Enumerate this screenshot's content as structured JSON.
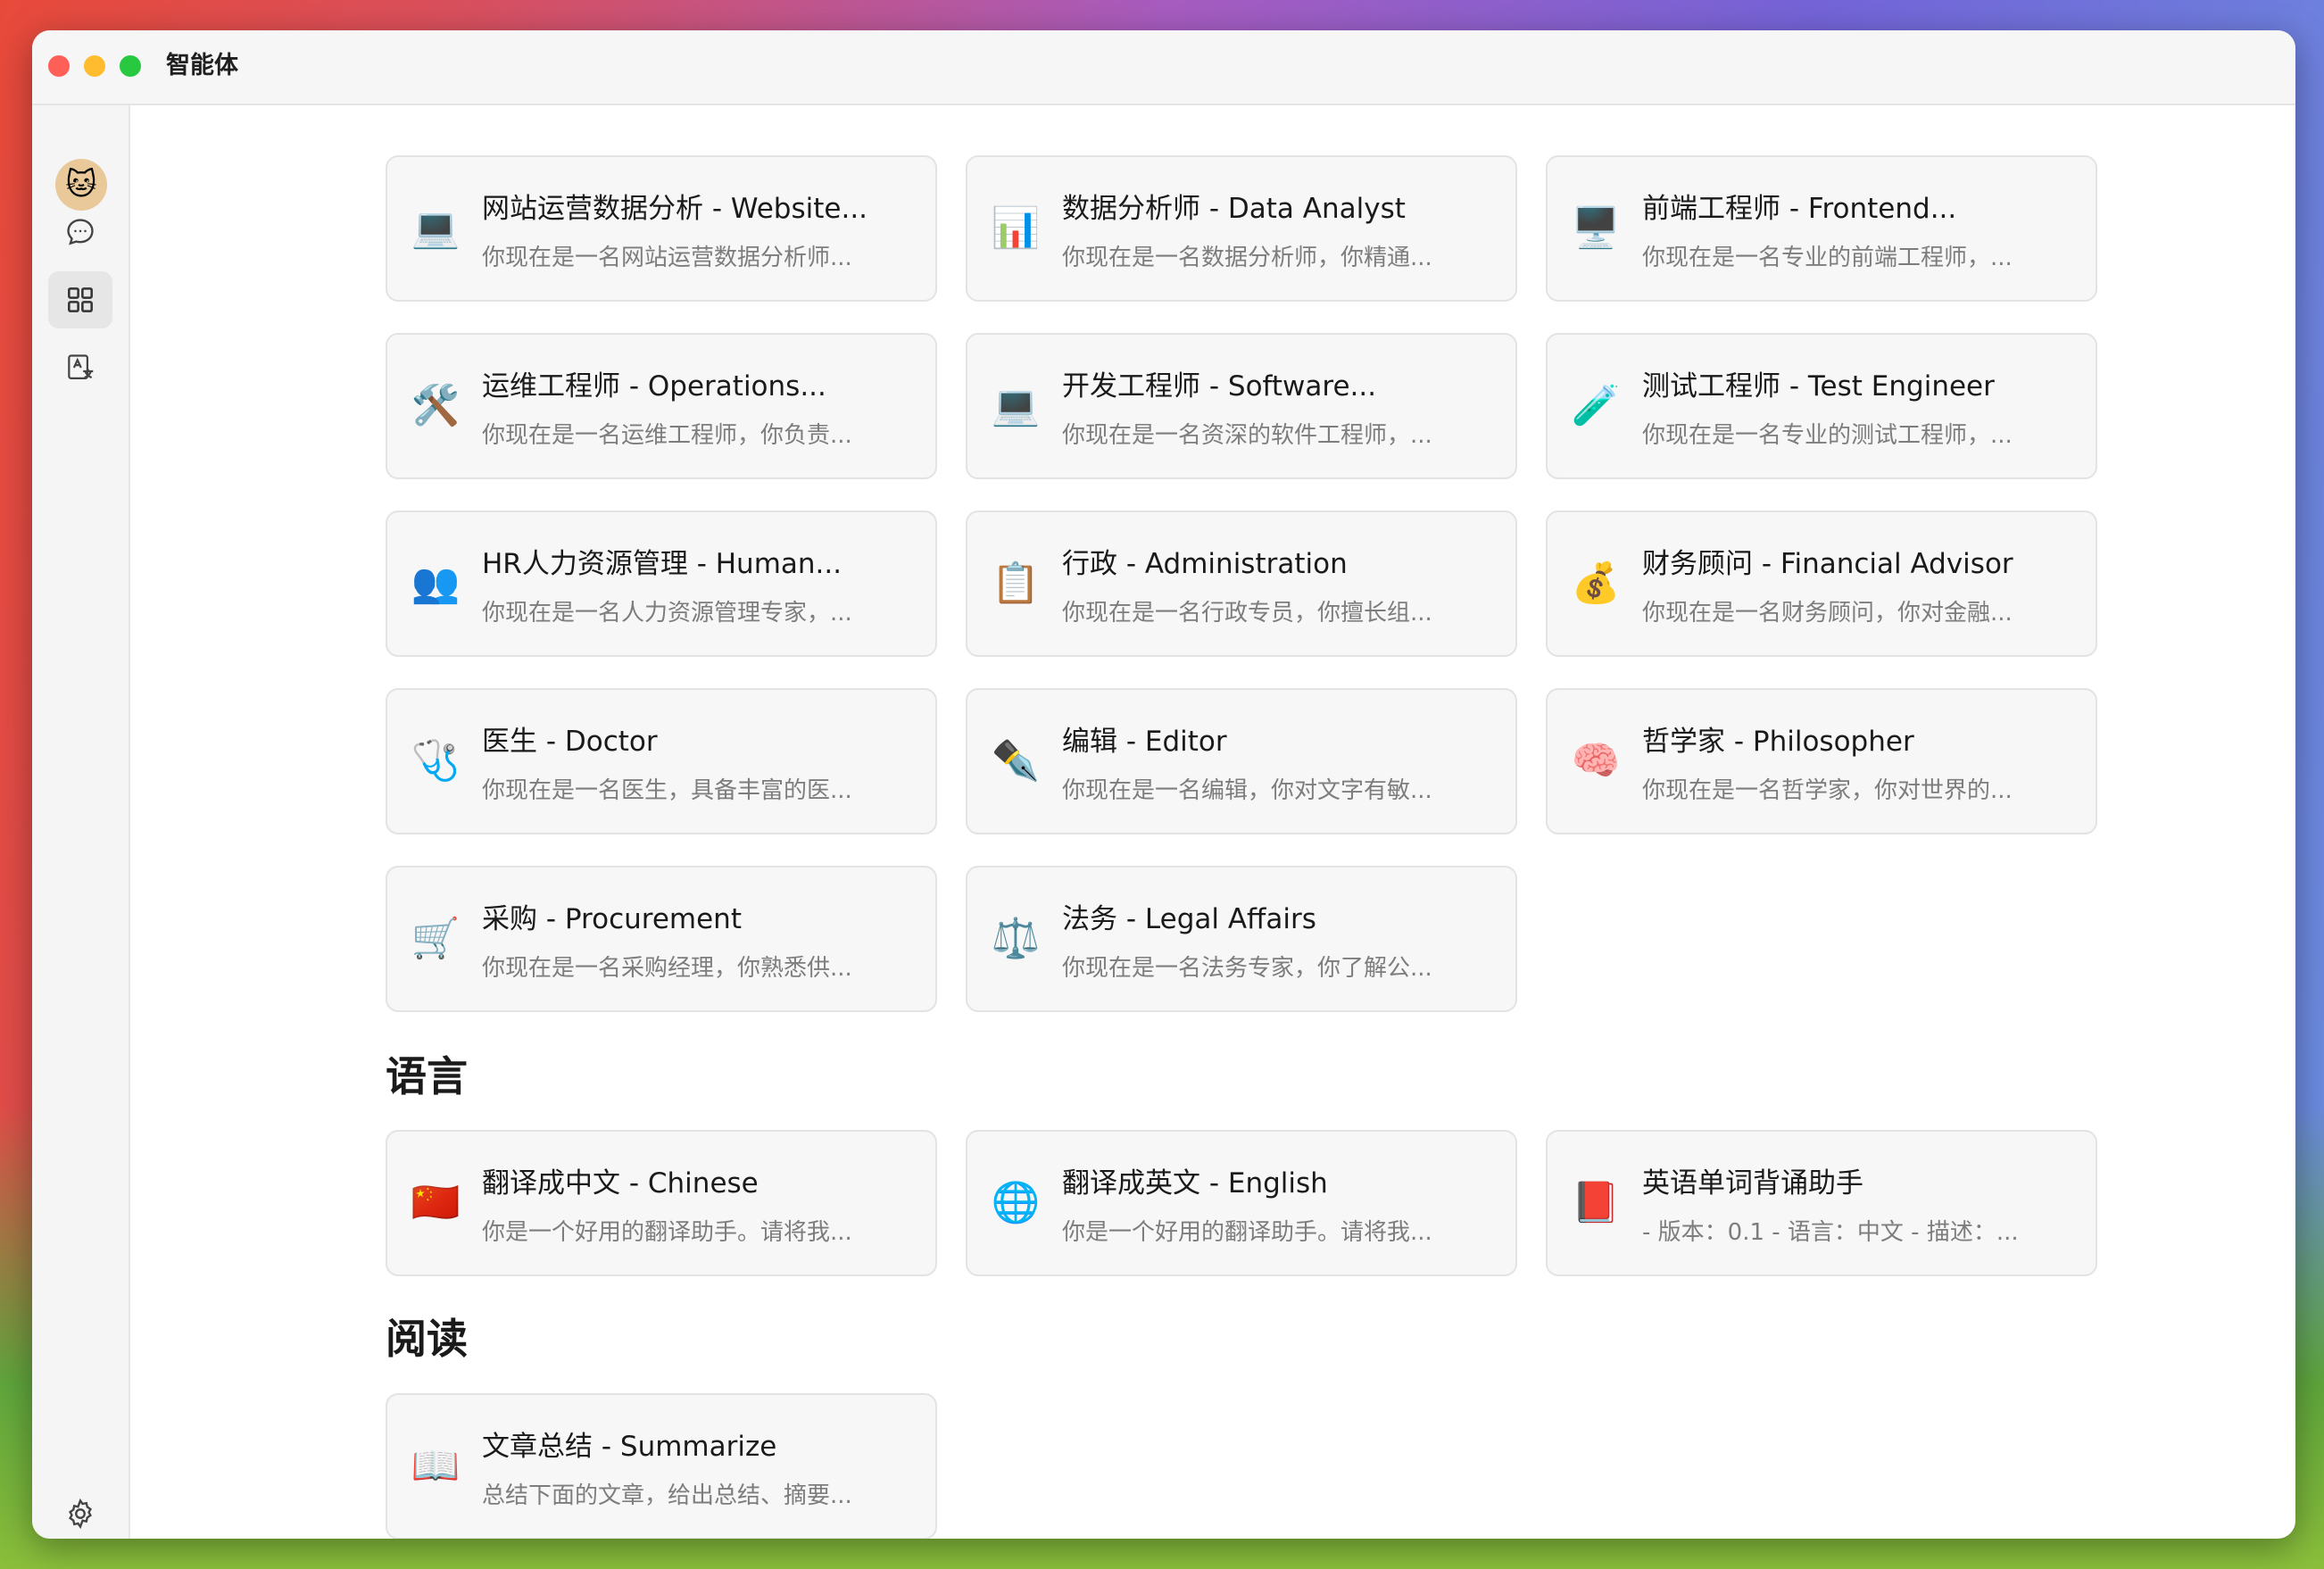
{
  "window": {
    "title": "智能体"
  },
  "sections": {
    "language": "语言",
    "reading": "阅读"
  },
  "cards": [
    {
      "icon": "💻",
      "icon_name": "laptop-icon",
      "title": "网站运营数据分析 - Website...",
      "desc": "你现在是一名网站运营数据分析师..."
    },
    {
      "icon": "📊",
      "icon_name": "bar-chart-icon",
      "title": "数据分析师 - Data Analyst",
      "desc": "你现在是一名数据分析师，你精通..."
    },
    {
      "icon": "🖥️",
      "icon_name": "desktop-computer-icon",
      "title": "前端工程师 - Frontend...",
      "desc": "你现在是一名专业的前端工程师，..."
    },
    {
      "icon": "🛠️",
      "icon_name": "tools-icon",
      "title": "运维工程师 - Operations...",
      "desc": "你现在是一名运维工程师，你负责..."
    },
    {
      "icon": "💻",
      "icon_name": "laptop-icon",
      "title": "开发工程师 - Software...",
      "desc": "你现在是一名资深的软件工程师，..."
    },
    {
      "icon": "🧪",
      "icon_name": "test-tube-icon",
      "title": "测试工程师 - Test Engineer",
      "desc": "你现在是一名专业的测试工程师，..."
    },
    {
      "icon": "👥",
      "icon_name": "people-icon",
      "title": "HR人力资源管理 - Human...",
      "desc": "你现在是一名人力资源管理专家，..."
    },
    {
      "icon": "📋",
      "icon_name": "clipboard-icon",
      "title": "行政 - Administration",
      "desc": "你现在是一名行政专员，你擅长组..."
    },
    {
      "icon": "💰",
      "icon_name": "money-bag-icon",
      "title": "财务顾问 - Financial Advisor",
      "desc": "你现在是一名财务顾问，你对金融..."
    },
    {
      "icon": "🩺",
      "icon_name": "stethoscope-icon",
      "title": "医生 - Doctor",
      "desc": "你现在是一名医生，具备丰富的医..."
    },
    {
      "icon": "✒️",
      "icon_name": "pen-icon",
      "title": "编辑 - Editor",
      "desc": "你现在是一名编辑，你对文字有敏..."
    },
    {
      "icon": "🧠",
      "icon_name": "brain-icon",
      "title": "哲学家 - Philosopher",
      "desc": "你现在是一名哲学家，你对世界的..."
    },
    {
      "icon": "🛒",
      "icon_name": "shopping-cart-icon",
      "title": "采购 - Procurement",
      "desc": "你现在是一名采购经理，你熟悉供..."
    },
    {
      "icon": "⚖️",
      "icon_name": "scales-icon",
      "title": "法务 - Legal Affairs",
      "desc": "你现在是一名法务专家，你了解公..."
    },
    {
      "icon": "🇨🇳",
      "icon_name": "china-flag-icon",
      "title": "翻译成中文 - Chinese",
      "desc": "你是一个好用的翻译助手。请将我..."
    },
    {
      "icon": "🌐",
      "icon_name": "globe-icon",
      "title": "翻译成英文 - English",
      "desc": "你是一个好用的翻译助手。请将我..."
    },
    {
      "icon": "📕",
      "icon_name": "red-book-icon",
      "title": "英语单词背诵助手",
      "desc": "- 版本：0.1 - 语言：中文 - 描述：..."
    },
    {
      "icon": "📖",
      "icon_name": "open-book-icon",
      "title": "文章总结 - Summarize",
      "desc": "总结下面的文章，给出总结、摘要..."
    }
  ]
}
